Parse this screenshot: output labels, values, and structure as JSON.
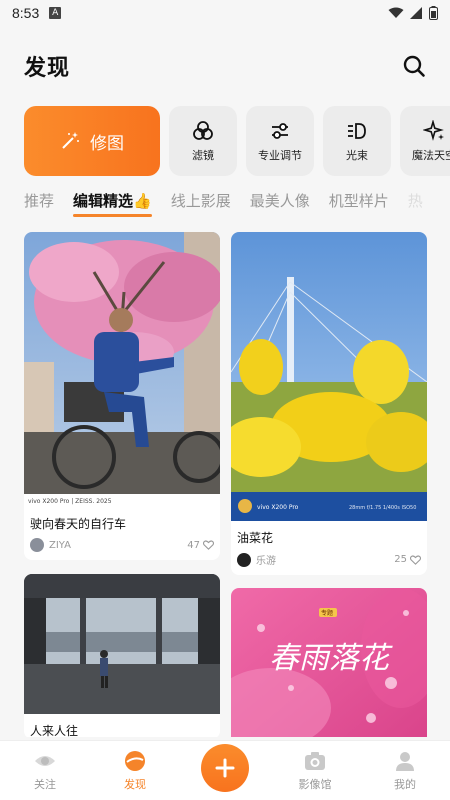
{
  "status_bar": {
    "time": "8:53",
    "badge": "A"
  },
  "header": {
    "title": "发现"
  },
  "tools": {
    "main": {
      "label": "修图",
      "icon": "magic-wand-icon"
    },
    "items": [
      {
        "label": "滤镜",
        "icon": "filter-icon"
      },
      {
        "label": "专业调节",
        "icon": "sliders-icon"
      },
      {
        "label": "光束",
        "icon": "light-beam-icon"
      },
      {
        "label": "魔法天空",
        "icon": "sparkle-icon"
      }
    ]
  },
  "tabs": [
    {
      "label": "推荐",
      "active": false
    },
    {
      "label": "编辑精选👍",
      "active": true
    },
    {
      "label": "线上影展",
      "active": false
    },
    {
      "label": "最美人像",
      "active": false
    },
    {
      "label": "机型样片",
      "active": false
    },
    {
      "label": "热",
      "active": false
    }
  ],
  "feed": [
    {
      "title": "驶向春天的自行车",
      "author": "ZIYA",
      "likes": "47",
      "watermark": "vivo X200 Pro | ZEISS. 2025"
    },
    {
      "title": "油菜花",
      "author": "乐游",
      "likes": "25",
      "watermark": "vivo X200 Pro",
      "exif": "28mm  f/1.75  1/400s  ISO50"
    },
    {
      "title": "人来人往",
      "author": "",
      "likes": ""
    },
    {
      "title": "",
      "author": "",
      "likes": "",
      "overlay_text": "春雨落花",
      "tag": "专题"
    }
  ],
  "bottom_nav": {
    "items": [
      {
        "label": "关注",
        "icon": "eye-icon"
      },
      {
        "label": "发现",
        "icon": "discover-icon"
      },
      {
        "label": "影像馆",
        "icon": "camera-icon"
      },
      {
        "label": "我的",
        "icon": "profile-icon"
      }
    ],
    "add_icon": "plus-icon"
  },
  "colors": {
    "accent": "#f5842a",
    "accent_gradient_start": "#fb8c2c",
    "background": "#f6f6f6"
  }
}
